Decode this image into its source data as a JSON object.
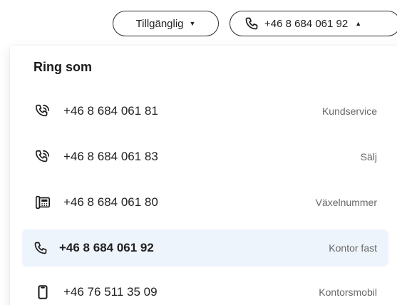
{
  "status_pill": {
    "label": "Tillgänglig",
    "caret_icon": "caret-down-icon"
  },
  "phone_pill": {
    "icon": "phone-icon",
    "label": "+46 8 684 061 92",
    "caret_icon": "caret-up-icon"
  },
  "dropdown": {
    "title": "Ring som",
    "options": [
      {
        "icon": "call-forward-phone-icon",
        "number": "+46 8 684 061 81",
        "label": "Kundservice",
        "selected": false
      },
      {
        "icon": "call-forward-phone-icon",
        "number": "+46 8 684 061 83",
        "label": "Sälj",
        "selected": false
      },
      {
        "icon": "switchboard-phone-icon",
        "number": "+46 8 684 061 80",
        "label": "Växelnummer",
        "selected": false
      },
      {
        "icon": "phone-icon",
        "number": "+46 8 684 061 92",
        "label": "Kontor fast",
        "selected": true
      },
      {
        "icon": "mobile-phone-icon",
        "number": "+46 76 511 35 09",
        "label": "Kontorsmobil",
        "selected": false
      }
    ]
  },
  "colors": {
    "selected_background": "#eef4fb",
    "pill_border": "#2b2b2b",
    "secondary_text": "#666666"
  }
}
